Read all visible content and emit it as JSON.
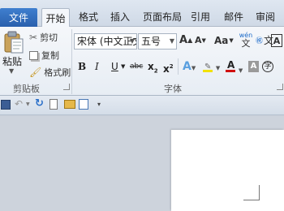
{
  "tabs": {
    "file": "文件",
    "home": "开始",
    "format": "格式",
    "insert": "插入",
    "layout": "页面布局",
    "references": "引用",
    "mailings": "邮件",
    "review": "审阅"
  },
  "clipboard": {
    "paste": "粘贴",
    "cut": "剪切",
    "copy": "复制",
    "format_painter": "格式刷",
    "group_label": "剪贴板"
  },
  "font": {
    "name": "宋体 (中文正文",
    "size": "五号",
    "grow": "A",
    "shrink": "A",
    "case": "Aa",
    "pinyin": "wén",
    "bold": "B",
    "italic": "I",
    "underline": "U",
    "strike": "abc",
    "subscript": "x",
    "superscript": "x",
    "text_effect": "A",
    "highlight_color": "#f2e200",
    "font_color": "#d01010",
    "font_color_letter": "A",
    "shade_letter": "A",
    "enclose_char": "字",
    "group_label": "字体"
  },
  "colors": {
    "file_tab": "#2a60ad",
    "ribbon": "#eef2f7",
    "page": "#ffffff"
  }
}
